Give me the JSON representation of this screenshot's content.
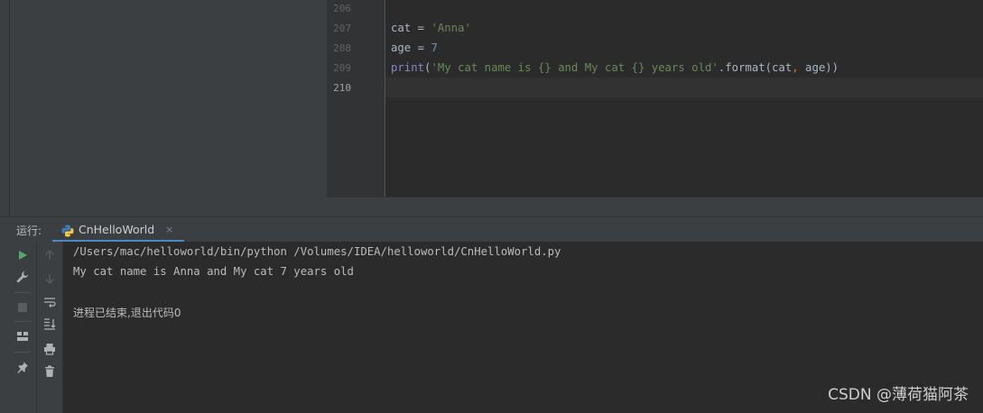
{
  "editor": {
    "line_numbers": [
      "206",
      "207",
      "208",
      "209",
      "210"
    ],
    "lines": {
      "l207": {
        "var": "cat",
        "eq": " = ",
        "str": "'Anna'"
      },
      "l208": {
        "var": "age",
        "eq": " = ",
        "num": "7"
      },
      "l209": {
        "fn": "print",
        "open": "(",
        "str": "'My cat name is {} and My cat {} years old'",
        "method": ".format(cat",
        "comma": ",",
        "rest": " age))"
      }
    }
  },
  "run_panel": {
    "label": "运行:",
    "tab_title": "CnHelloWorld",
    "tab_close": "×"
  },
  "console": {
    "lines": [
      "/Users/mac/helloworld/bin/python /Volumes/IDEA/helloworld/CnHelloWorld.py",
      "My cat name is Anna and My cat 7 years old",
      "",
      "进程已结束,退出代码0"
    ]
  },
  "watermark": "CSDN @薄荷猫阿茶",
  "icons": {
    "toolbar1": [
      "run-icon",
      "wrench-icon",
      "stop-icon",
      "layout-icon",
      "pin-icon"
    ],
    "toolbar2": [
      "up-arrow-icon",
      "down-arrow-icon",
      "soft-wrap-icon",
      "scroll-to-end-icon",
      "print-icon",
      "trash-icon"
    ]
  },
  "colors": {
    "background": "#2b2b2b",
    "panel": "#3c3f41",
    "string": "#6a8759",
    "number": "#6897bb",
    "builtin": "#8888c6",
    "keyword_punc": "#cc7832",
    "accent": "#4a88c7",
    "run_green": "#59a869"
  }
}
